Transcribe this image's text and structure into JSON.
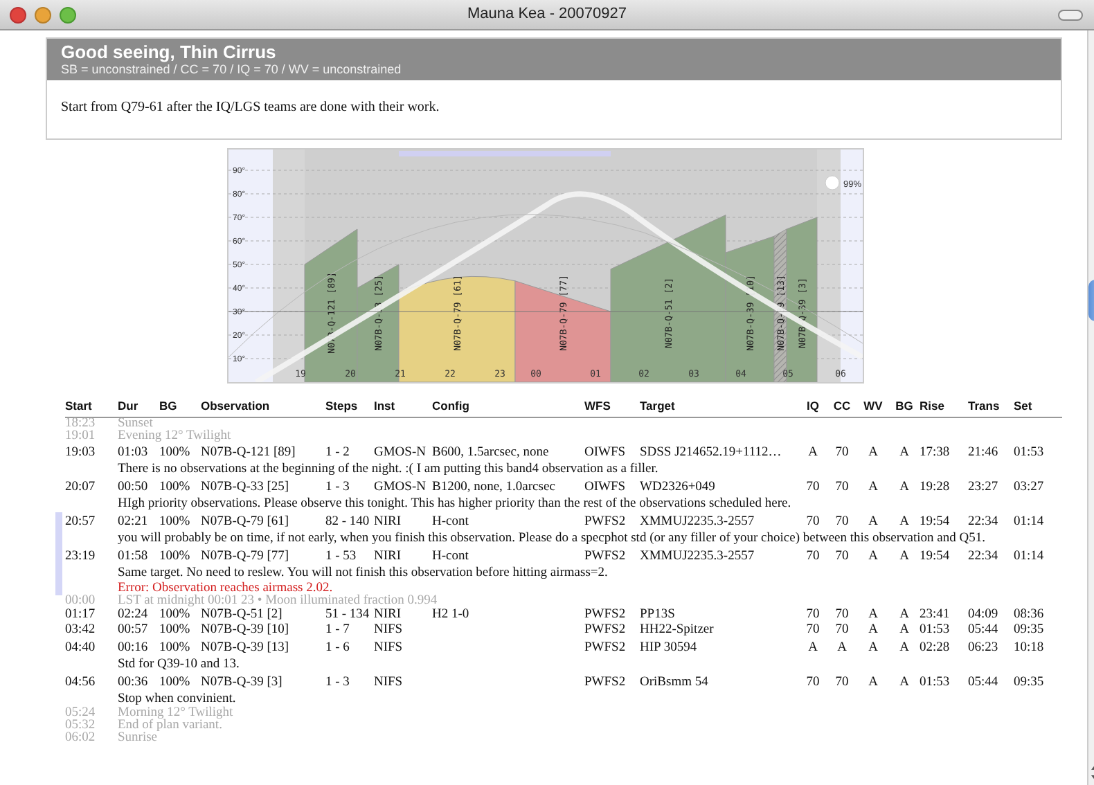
{
  "window": {
    "title": "Mauna Kea - 20070927"
  },
  "conditions": {
    "title": "Good seeing, Thin Cirrus",
    "summary": "SB = unconstrained / CC = 70 / IQ = 70 / WV = unconstrained",
    "note": "Start from Q79-61 after the IQ/LGS teams are done with their work."
  },
  "plot": {
    "moon": "99%",
    "yticks": [
      "90°",
      "80°",
      "70°",
      "60°",
      "50°",
      "40°",
      "30°",
      "20°",
      "10°"
    ],
    "xticks": [
      "19",
      "20",
      "21",
      "22",
      "23",
      "00",
      "01",
      "02",
      "03",
      "04",
      "05",
      "06"
    ],
    "blocks": [
      {
        "label": "N07B-Q-121 [89]",
        "color": "#8fa888",
        "hatched": false
      },
      {
        "label": "N07B-Q-33 [25]",
        "color": "#8fa888",
        "hatched": false
      },
      {
        "label": "N07B-Q-79 [61]",
        "color": "#e6d184",
        "hatched": false
      },
      {
        "label": "N07B-Q-79 [77]",
        "color": "#df9494",
        "hatched": false
      },
      {
        "label": "N07B-Q-51 [2]",
        "color": "#8fa888",
        "hatched": false
      },
      {
        "label": "N07B-Q-39 [10]",
        "color": "#8fa888",
        "hatched": false
      },
      {
        "label": "N07B-Q-39 [13]",
        "color": "#b5b5b0",
        "hatched": true
      },
      {
        "label": "N07B-Q-39 [3]",
        "color": "#8fa888",
        "hatched": false
      }
    ]
  },
  "schedule": {
    "columns": [
      "Start",
      "Dur",
      "BG",
      "Observation",
      "Steps",
      "Inst",
      "Config",
      "WFS",
      "Target",
      "IQ",
      "CC",
      "WV",
      "BG",
      "Rise",
      "Trans",
      "Set"
    ],
    "rows": [
      {
        "kind": "event",
        "start": "18:23",
        "text": "Sunset"
      },
      {
        "kind": "event",
        "start": "19:01",
        "text": "Evening 12° Twilight"
      },
      {
        "kind": "observation",
        "selected": false,
        "start": "19:03",
        "dur": "01:03",
        "bg": "100%",
        "observation": "N07B-Q-121 [89]",
        "steps": "1 - 2",
        "inst": "GMOS-N",
        "config": "B600, 1.5arcsec, none",
        "wfs": "OIWFS",
        "target": "SDSS J214652.19+1112…",
        "iq": "A",
        "cc": "70",
        "wv": "A",
        "bg_cond": "A",
        "rise": "17:38",
        "trans": "21:46",
        "set": "01:53",
        "notes": [
          {
            "kind": "comment",
            "text": "There is no observations at the beginning of the night. :( I am putting this band4 observation as a filler."
          }
        ]
      },
      {
        "kind": "observation",
        "selected": false,
        "start": "20:07",
        "dur": "00:50",
        "bg": "100%",
        "observation": "N07B-Q-33 [25]",
        "steps": "1 - 3",
        "inst": "GMOS-N",
        "config": "B1200, none, 1.0arcsec",
        "wfs": "OIWFS",
        "target": "WD2326+049",
        "iq": "70",
        "cc": "70",
        "wv": "A",
        "bg_cond": "A",
        "rise": "19:28",
        "trans": "23:27",
        "set": "03:27",
        "notes": [
          {
            "kind": "comment",
            "text": "HIgh priority observations. Please observe this tonight. This has higher priority than the rest of the observations scheduled here."
          }
        ]
      },
      {
        "kind": "observation",
        "selected": true,
        "start": "20:57",
        "dur": "02:21",
        "bg": "100%",
        "observation": "N07B-Q-79 [61]",
        "steps": "82 - 140",
        "inst": "NIRI",
        "config": "H-cont",
        "wfs": "PWFS2",
        "target": "XMMUJ2235.3-2557",
        "iq": "70",
        "cc": "70",
        "wv": "A",
        "bg_cond": "A",
        "rise": "19:54",
        "trans": "22:34",
        "set": "01:14",
        "notes": [
          {
            "kind": "comment",
            "text": "you will probably be on time, if not early, when you finish this observation. Please do a specphot std (or any filler of your choice) between this observation and Q51."
          }
        ]
      },
      {
        "kind": "observation",
        "selected": true,
        "start": "23:19",
        "dur": "01:58",
        "bg": "100%",
        "observation": "N07B-Q-79 [77]",
        "steps": "1 - 53",
        "inst": "NIRI",
        "config": "H-cont",
        "wfs": "PWFS2",
        "target": "XMMUJ2235.3-2557",
        "iq": "70",
        "cc": "70",
        "wv": "A",
        "bg_cond": "A",
        "rise": "19:54",
        "trans": "22:34",
        "set": "01:14",
        "notes": [
          {
            "kind": "comment",
            "text": "Same target. No need to reslew. You will not finish this observation before hitting airmass=2."
          },
          {
            "kind": "error",
            "text": "Error: Observation reaches airmass 2.02."
          }
        ]
      },
      {
        "kind": "event",
        "start": "00:00",
        "text": "LST at midnight 00:01 23 • Moon illuminated fraction 0.994"
      },
      {
        "kind": "observation",
        "selected": false,
        "start": "01:17",
        "dur": "02:24",
        "bg": "100%",
        "observation": "N07B-Q-51 [2]",
        "steps": "51 - 134",
        "inst": "NIRI",
        "config": "H2 1-0",
        "wfs": "PWFS2",
        "target": "PP13S",
        "iq": "70",
        "cc": "70",
        "wv": "A",
        "bg_cond": "A",
        "rise": "23:41",
        "trans": "04:09",
        "set": "08:36",
        "notes": []
      },
      {
        "kind": "observation",
        "selected": false,
        "start": "03:42",
        "dur": "00:57",
        "bg": "100%",
        "observation": "N07B-Q-39 [10]",
        "steps": "1 - 7",
        "inst": "NIFS",
        "wfs": "PWFS2",
        "target": "HH22-Spitzer",
        "iq": "70",
        "cc": "70",
        "wv": "A",
        "bg_cond": "A",
        "rise": "01:53",
        "trans": "05:44",
        "set": "09:35",
        "notes": []
      },
      {
        "kind": "observation",
        "selected": false,
        "start": "04:40",
        "dur": "00:16",
        "bg": "100%",
        "observation": "N07B-Q-39 [13]",
        "steps": "1 - 6",
        "inst": "NIFS",
        "wfs": "PWFS2",
        "target": "HIP 30594",
        "iq": "A",
        "cc": "A",
        "wv": "A",
        "bg_cond": "A",
        "rise": "02:28",
        "trans": "06:23",
        "set": "10:18",
        "notes": [
          {
            "kind": "comment",
            "text": "Std for Q39-10 and 13."
          }
        ]
      },
      {
        "kind": "observation",
        "selected": false,
        "start": "04:56",
        "dur": "00:36",
        "bg": "100%",
        "observation": "N07B-Q-39 [3]",
        "steps": "1 - 3",
        "inst": "NIFS",
        "wfs": "PWFS2",
        "target": "OriBsmm 54",
        "iq": "70",
        "cc": "70",
        "wv": "A",
        "bg_cond": "A",
        "rise": "01:53",
        "trans": "05:44",
        "set": "09:35",
        "notes": [
          {
            "kind": "comment",
            "text": "Stop when convinient."
          }
        ]
      },
      {
        "kind": "event",
        "start": "05:24",
        "text": "Morning 12° Twilight"
      },
      {
        "kind": "event",
        "start": "05:32",
        "text": "End of plan variant."
      },
      {
        "kind": "event",
        "start": "06:02",
        "text": "Sunrise"
      }
    ]
  }
}
